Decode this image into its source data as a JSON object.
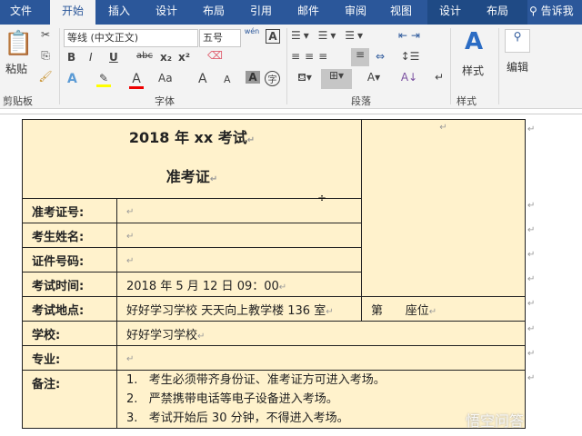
{
  "tabs": [
    "文件",
    "开始",
    "插入",
    "设计",
    "布局",
    "引用",
    "邮件",
    "审阅",
    "视图",
    "设计",
    "布局"
  ],
  "tell_me": "告诉我",
  "clipboard": {
    "paste": "粘贴",
    "group": "剪贴板"
  },
  "font": {
    "name": "等线 (中文正文)",
    "size": "五号",
    "bold": "B",
    "italic": "I",
    "underline": "U",
    "strike": "abc",
    "sub": "x₂",
    "sup": "x²",
    "case": "Aa",
    "grow": "A",
    "shrink": "A",
    "group": "字体",
    "phonetic": "wén"
  },
  "paragraph": {
    "group": "段落"
  },
  "styles": {
    "label": "样式",
    "group": "样式"
  },
  "editing": {
    "label": "编辑"
  },
  "doc": {
    "title": "2018 年 xx 考试",
    "subtitle": "准考证",
    "rows": [
      {
        "label": "准考证号:",
        "value": ""
      },
      {
        "label": "考生姓名:",
        "value": ""
      },
      {
        "label": "证件号码:",
        "value": ""
      },
      {
        "label": "考试时间:",
        "value": "2018 年 5 月 12 日  09：00"
      },
      {
        "label": "考试地点:",
        "value": "好好学习学校  天天向上教学楼 136 室",
        "extra": "第      座位"
      },
      {
        "label": "学校:",
        "value": "好好学习学校"
      },
      {
        "label": "专业:",
        "value": ""
      },
      {
        "label": "备注:",
        "notes": [
          "1.   考生必须带齐身份证、准考证方可进入考场。",
          "2.   严禁携带电话等电子设备进入考场。",
          "3.   考试开始后 30 分钟，不得进入考场。"
        ]
      }
    ],
    "para_mark": "↵"
  },
  "watermark": "悟空问答",
  "colors": {
    "tabbar": "#2b579a",
    "cell": "#fff2cc"
  }
}
